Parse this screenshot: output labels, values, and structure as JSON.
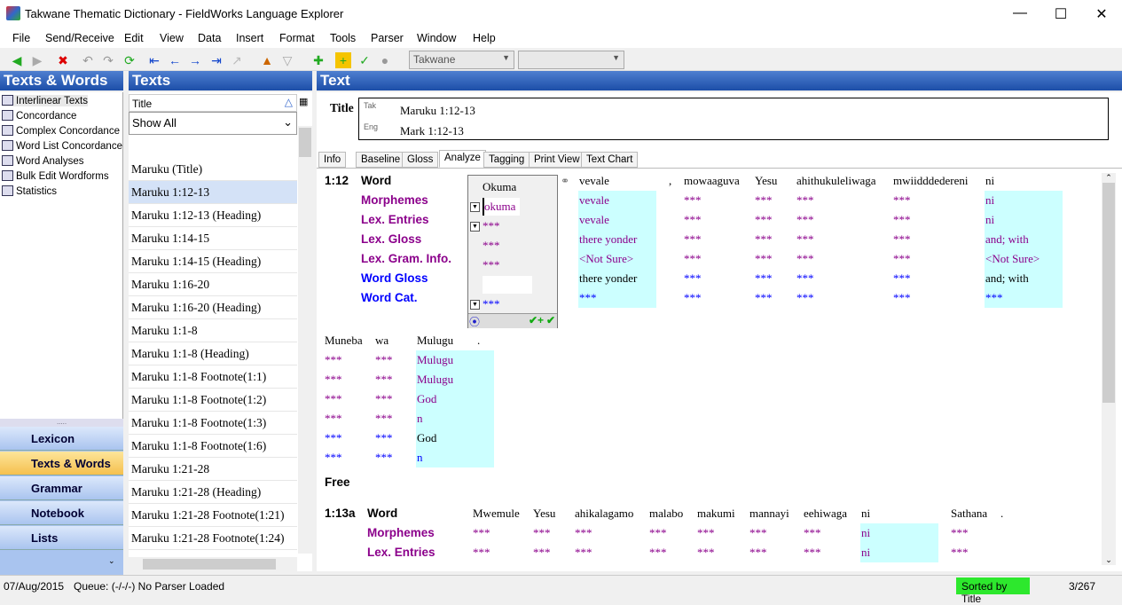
{
  "window": {
    "title": "Takwane Thematic Dictionary - FieldWorks Language Explorer"
  },
  "menu": [
    "File",
    "Send/Receive",
    "Edit",
    "View",
    "Data",
    "Insert",
    "Format",
    "Tools",
    "Parser",
    "Window",
    "Help"
  ],
  "toolbar": {
    "writing_system": "Takwane",
    "second_combo": ""
  },
  "left": {
    "header": "Texts & Words",
    "items": [
      "Interlinear Texts",
      "Concordance",
      "Complex Concordance",
      "Word List Concordance",
      "Word Analyses",
      "Bulk Edit Wordforms",
      "Statistics"
    ],
    "selected": 0,
    "nav": [
      {
        "label": "Lexicon",
        "color": "#c0392b"
      },
      {
        "label": "Texts & Words",
        "color": "#e6b800"
      },
      {
        "label": "Grammar",
        "color": "#2e7dd1"
      },
      {
        "label": "Notebook",
        "color": "#3b5bab"
      },
      {
        "label": "Lists",
        "color": "#5b3fa0"
      }
    ],
    "nav_selected": 1
  },
  "texts": {
    "header": "Texts",
    "column": "Title",
    "filter": "Show All",
    "selected": 1,
    "rows": [
      "Maruku (Title)",
      "Maruku 1:12-13",
      "Maruku 1:12-13 (Heading)",
      "Maruku 1:14-15",
      "Maruku 1:14-15 (Heading)",
      "Maruku 1:16-20",
      "Maruku 1:16-20 (Heading)",
      "Maruku 1:1-8",
      "Maruku 1:1-8 (Heading)",
      "Maruku 1:1-8 Footnote(1:1)",
      "Maruku 1:1-8 Footnote(1:2)",
      "Maruku 1:1-8 Footnote(1:3)",
      "Maruku 1:1-8 Footnote(1:6)",
      "Maruku 1:21-28",
      "Maruku 1:21-28 (Heading)",
      "Maruku 1:21-28 Footnote(1:21)",
      "Maruku 1:21-28 Footnote(1:24)"
    ]
  },
  "text": {
    "header": "Text",
    "title_label": "Title",
    "titles": [
      {
        "ws": "Tak",
        "value": "Maruku 1:12-13"
      },
      {
        "ws": "Eng",
        "value": "Mark 1:12-13"
      }
    ],
    "tabs": [
      "Info",
      "Baseline",
      "Gloss",
      "Analyze",
      "Tagging",
      "Print View",
      "Text Chart"
    ],
    "selected_tab": 3,
    "line_labels": [
      "Word",
      "Morphemes",
      "Lex. Entries",
      "Lex. Gloss",
      "Lex. Gram. Info.",
      "Word Gloss",
      "Word Cat."
    ],
    "colors": {
      "word": "#000000",
      "lex": "#8b008b",
      "wordlevel": "#0000ff",
      "highlight": "#ccffff"
    },
    "sandbox": {
      "word": "Okuma",
      "lines": [
        "okuma",
        "***",
        "***",
        "***",
        "",
        "***"
      ]
    },
    "segments": [
      {
        "ref": "1:12",
        "rows": [
          [
            {
              "w": "vevale",
              "l": [
                "vevale",
                "vevale",
                "there yonder",
                "<Not Sure>",
                "there yonder",
                "***"
              ],
              "hl": true
            },
            {
              "w": ",",
              "l": []
            },
            {
              "w": "mowaaguva",
              "l": [
                "***",
                "***",
                "***",
                "***",
                "***",
                "***"
              ]
            },
            {
              "w": "Yesu",
              "l": [
                "***",
                "***",
                "***",
                "***",
                "***",
                "***"
              ]
            },
            {
              "w": "ahithukuleliwaga",
              "l": [
                "***",
                "***",
                "***",
                "***",
                "***",
                "***"
              ]
            },
            {
              "w": "mwiidddedereni",
              "l": [
                "***",
                "***",
                "***",
                "***",
                "***",
                "***"
              ]
            },
            {
              "w": "ni",
              "l": [
                "ni",
                "ni",
                "and; with",
                "<Not Sure>",
                "and; with",
                "***"
              ],
              "hl": true
            }
          ],
          [
            {
              "w": "Muneba",
              "l": [
                "***",
                "***",
                "***",
                "***",
                "***",
                "***"
              ]
            },
            {
              "w": "wa",
              "l": [
                "***",
                "***",
                "***",
                "***",
                "***",
                "***"
              ]
            },
            {
              "w": "Mulugu",
              "l": [
                "Mulugu",
                "Mulugu",
                "God",
                "n",
                "God",
                "n"
              ],
              "hl": true
            },
            {
              "w": ".",
              "l": []
            }
          ]
        ],
        "free_label": "Free"
      },
      {
        "ref": "1:13a",
        "rows": [
          [
            {
              "w": "Mwemule",
              "l": [
                "***",
                "***"
              ]
            },
            {
              "w": "Yesu",
              "l": [
                "***",
                "***"
              ]
            },
            {
              "w": "ahikalagamo",
              "l": [
                "***",
                "***"
              ]
            },
            {
              "w": "malabo",
              "l": [
                "***",
                "***"
              ]
            },
            {
              "w": "makumi",
              "l": [
                "***",
                "***"
              ]
            },
            {
              "w": "mannayi",
              "l": [
                "***",
                "***"
              ]
            },
            {
              "w": "eehiwaga",
              "l": [
                "***",
                "***"
              ]
            },
            {
              "w": "ni",
              "l": [
                "ni",
                "ni"
              ],
              "hl": true
            },
            {
              "w": "Sathana",
              "l": [
                "***",
                "***"
              ]
            },
            {
              "w": ".",
              "l": []
            }
          ]
        ]
      }
    ]
  },
  "status": {
    "date": "07/Aug/2015",
    "queue": "Queue: (-/-/-) No Parser Loaded",
    "sort": "Sorted by Title",
    "count": "3/267"
  }
}
